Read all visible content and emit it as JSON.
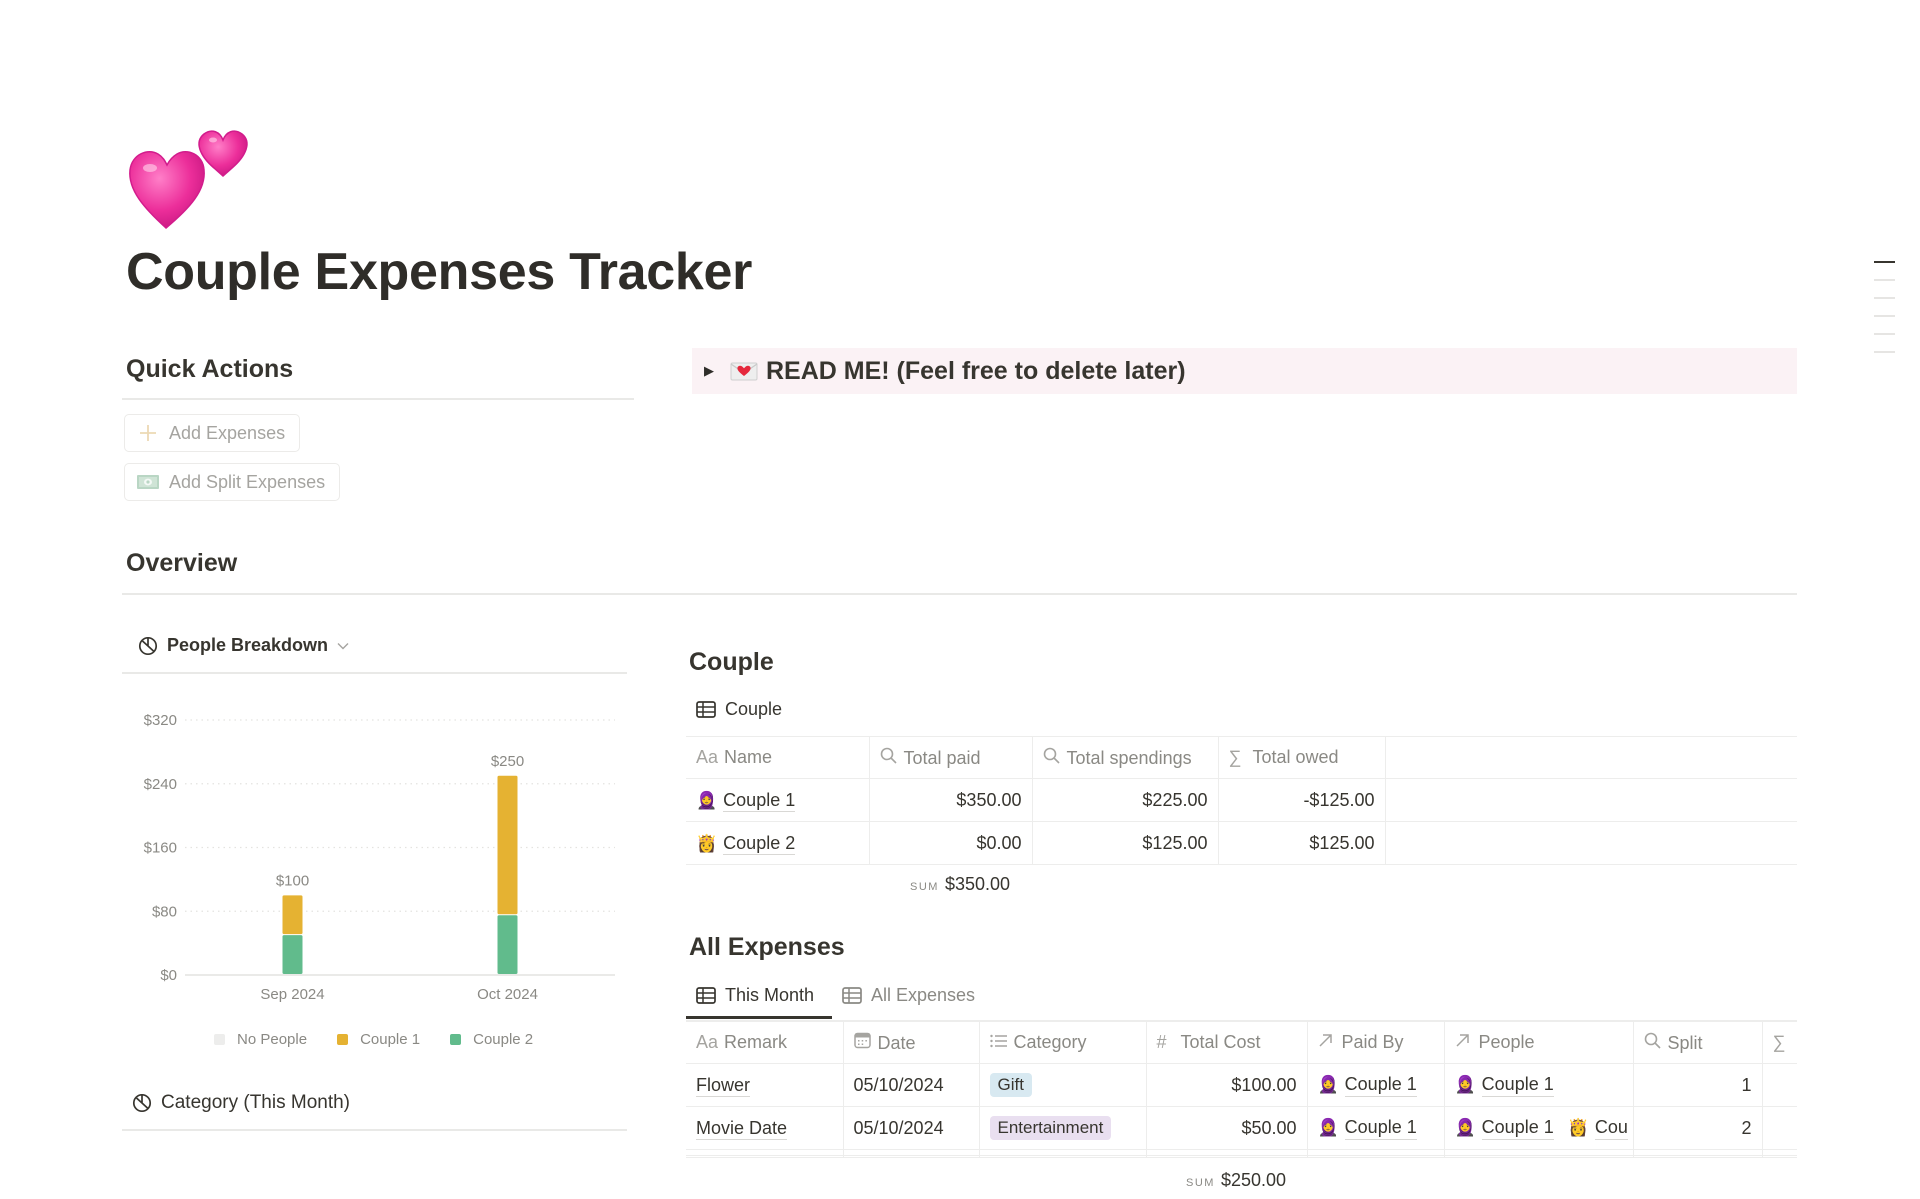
{
  "page": {
    "icon": "two-hearts-icon",
    "title": "Couple Expenses Tracker"
  },
  "quick_actions": {
    "heading": "Quick Actions",
    "buttons": [
      {
        "label": "Add Expenses",
        "icon": "plus-icon"
      },
      {
        "label": "Add Split Expenses",
        "icon": "banknote-icon"
      }
    ]
  },
  "callout": {
    "icon": "love-letter-icon",
    "text": "READ ME! (Feel free to delete later)",
    "collapsed": true
  },
  "overview": {
    "heading": "Overview",
    "people_chart_title": "People Breakdown",
    "category_chart_title": "Category (This Month)"
  },
  "chart_data": {
    "type": "bar",
    "stacked": true,
    "title": "People Breakdown",
    "categories": [
      "Sep 2024",
      "Oct 2024"
    ],
    "series": [
      {
        "name": "No People",
        "values": [
          0,
          0
        ],
        "color": "#ededec"
      },
      {
        "name": "Couple 1",
        "values": [
          50,
          175
        ],
        "color": "#e5b232"
      },
      {
        "name": "Couple 2",
        "values": [
          50,
          75
        ],
        "color": "#61bb8c"
      }
    ],
    "totals": [
      100,
      250
    ],
    "total_labels": [
      "$100",
      "$250"
    ],
    "yticks": [
      0,
      80,
      160,
      240,
      320
    ],
    "ytick_labels": [
      "$0",
      "$80",
      "$160",
      "$240",
      "$320"
    ],
    "ylim": [
      0,
      320
    ],
    "xlabel": "",
    "ylabel": "",
    "grid": true,
    "legend_position": "bottom"
  },
  "couple": {
    "heading": "Couple",
    "view_label": "Couple",
    "columns": [
      {
        "label": "Name",
        "icon": "Aa"
      },
      {
        "label": "Total paid",
        "icon": "search-icon"
      },
      {
        "label": "Total spendings",
        "icon": "search-icon"
      },
      {
        "label": "Total owed",
        "icon": "sigma-icon"
      }
    ],
    "rows": [
      {
        "emoji": "🧕",
        "name": "Couple 1",
        "total_paid": "$350.00",
        "total_spendings": "$225.00",
        "total_owed": "-$125.00"
      },
      {
        "emoji": "👸",
        "name": "Couple 2",
        "total_paid": "$0.00",
        "total_spendings": "$125.00",
        "total_owed": "$125.00"
      }
    ],
    "sum_label": "SUM",
    "sum_value": "$350.00"
  },
  "all_expenses": {
    "heading": "All Expenses",
    "tabs": [
      {
        "label": "This Month",
        "active": true
      },
      {
        "label": "All Expenses",
        "active": false
      }
    ],
    "columns": [
      {
        "label": "Remark",
        "icon": "Aa"
      },
      {
        "label": "Date",
        "icon": "calendar-icon"
      },
      {
        "label": "Category",
        "icon": "list-icon"
      },
      {
        "label": "Total Cost",
        "icon": "#"
      },
      {
        "label": "Paid By",
        "icon": "relation-arrow-icon"
      },
      {
        "label": "People",
        "icon": "relation-arrow-icon"
      },
      {
        "label": "Split",
        "icon": "search-icon"
      },
      {
        "label": "",
        "icon": "sigma-icon"
      }
    ],
    "rows": [
      {
        "remark": "Flower",
        "date": "05/10/2024",
        "category": "Gift",
        "category_color": "#d8e9f1",
        "total_cost": "$100.00",
        "paid_by": {
          "emoji": "🧕",
          "name": "Couple 1"
        },
        "people": [
          {
            "emoji": "🧕",
            "name": "Couple 1"
          }
        ],
        "split": "1"
      },
      {
        "remark": "Movie Date",
        "date": "05/10/2024",
        "category": "Entertainment",
        "category_color": "#e9dff0",
        "total_cost": "$50.00",
        "paid_by": {
          "emoji": "🧕",
          "name": "Couple 1"
        },
        "people": [
          {
            "emoji": "🧕",
            "name": "Couple 1"
          },
          {
            "emoji": "👸",
            "name": "Cou"
          }
        ],
        "split": "2"
      }
    ],
    "sum_label": "SUM",
    "sum_value": "$250.00"
  }
}
